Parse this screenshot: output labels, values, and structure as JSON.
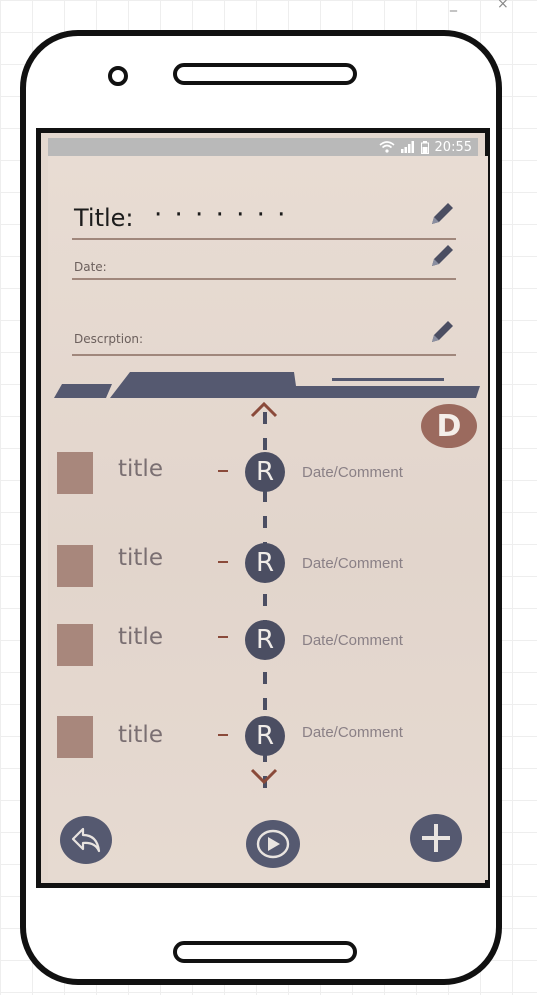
{
  "window_controls": [
    "_",
    "×"
  ],
  "status_bar": {
    "wifi_icon": "wifi-icon",
    "signal_icon": "signal-icon",
    "battery_icon": "battery-icon",
    "time": "20:55"
  },
  "form": {
    "title_label": "Title:",
    "title_value": "· · · · · · ·",
    "date_label": "Date:",
    "description_label": "Descrption:"
  },
  "timeline_badge": "D",
  "items": [
    {
      "title": "title",
      "marker": "R",
      "date": "Date/Comment"
    },
    {
      "title": "title",
      "marker": "R",
      "date": "Date/Comment"
    },
    {
      "title": "title",
      "marker": "R",
      "date": "Date/Comment"
    },
    {
      "title": "title",
      "marker": "R",
      "date": "Date/Comment"
    }
  ],
  "bottom_bar": {
    "back": "back-arrow-icon",
    "play": "play-icon",
    "add": "plus-icon"
  },
  "colors": {
    "screen_bg": "#e4d8cf",
    "accent_dark": "#4b4e62",
    "accent_brown": "#9b6a5e",
    "thumb": "#a8877c"
  }
}
